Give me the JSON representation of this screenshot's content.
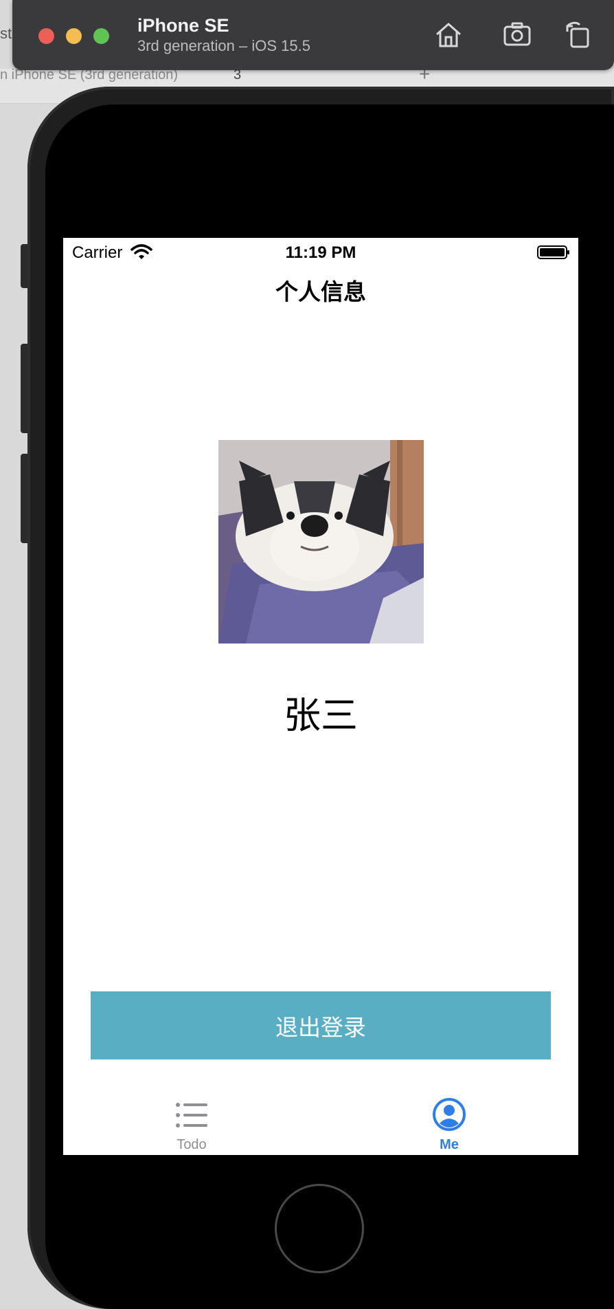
{
  "simulator": {
    "device_name": "iPhone SE",
    "device_subtitle": "3rd generation – iOS 15.5",
    "background_tab_text": "n iPhone SE (3rd generation)",
    "background_badge": "3",
    "background_left_text": "st"
  },
  "status_bar": {
    "carrier": "Carrier",
    "time": "11:19 PM"
  },
  "nav": {
    "title": "个人信息"
  },
  "profile": {
    "avatar_icon": "dog-photo",
    "name": "张三"
  },
  "logout": {
    "label": "退出登录",
    "color": "#5aaec4"
  },
  "tabs": [
    {
      "label": "Todo",
      "icon": "list-icon",
      "selected": false
    },
    {
      "label": "Me",
      "icon": "person-circle-icon",
      "selected": true
    }
  ],
  "colors": {
    "accent": "#2f7ee8",
    "tab_inactive": "#8e8e93"
  }
}
